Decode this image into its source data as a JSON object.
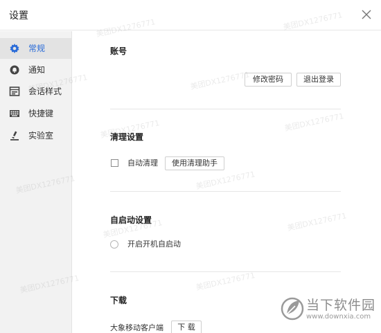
{
  "window": {
    "title": "设置"
  },
  "sidebar": {
    "items": [
      {
        "label": "常规",
        "icon": "gear-icon",
        "active": true
      },
      {
        "label": "通知",
        "icon": "bell-icon",
        "active": false
      },
      {
        "label": "会话样式",
        "icon": "chat-style-icon",
        "active": false
      },
      {
        "label": "快捷键",
        "icon": "keyboard-icon",
        "active": false
      },
      {
        "label": "实验室",
        "icon": "flask-icon",
        "active": false
      }
    ]
  },
  "account": {
    "title": "账号",
    "change_password": "修改密码",
    "logout": "退出登录"
  },
  "cleanup": {
    "title": "清理设置",
    "auto_clean": "自动清理",
    "auto_clean_checked": false,
    "use_assistant": "使用清理助手"
  },
  "autostart": {
    "title": "自启动设置",
    "boot_start": "开启开机自启动",
    "boot_start_checked": false
  },
  "download": {
    "title": "下载",
    "mobile_client": "大象移动客户端",
    "download_button": "下 载"
  },
  "watermark": {
    "text": "美团DX1276771"
  },
  "site_logo": {
    "name": "当下软件园",
    "url": "www.downxia.com"
  },
  "colors": {
    "accent": "#2b6cd8",
    "sidebar_bg": "#f2f2f2",
    "active_bg": "#e3e3e3"
  }
}
